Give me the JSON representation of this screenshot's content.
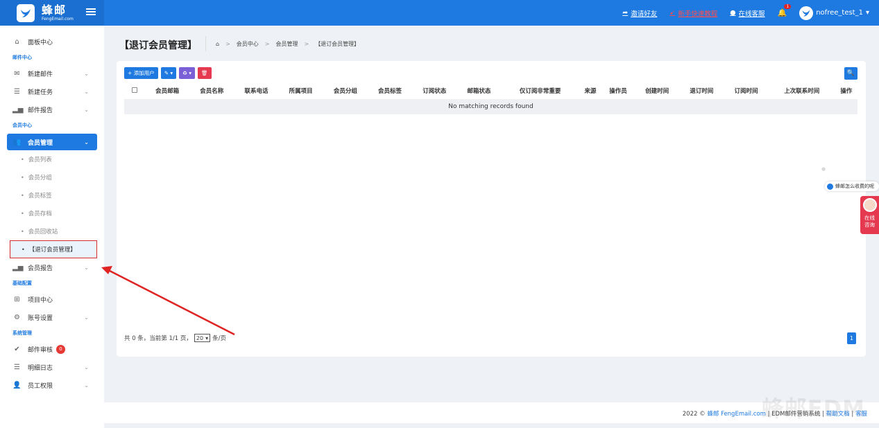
{
  "brand": {
    "name_cn": "蜂邮",
    "name_en": "FengEmail.com"
  },
  "topbar": {
    "invite": "邀请好友",
    "tutorial": "新手快速教程",
    "support": "在线客服",
    "bell_count": "1",
    "username": "nofree_test_1"
  },
  "sidebar": {
    "dashboard": "面板中心",
    "section_mail": "邮件中心",
    "new_mail": "新建邮件",
    "new_task": "新建任务",
    "mail_report": "邮件报告",
    "section_member": "会员中心",
    "member_manage": "会员管理",
    "sub": [
      "会员列表",
      "会员分组",
      "会员标签",
      "会员存档",
      "会员回收站",
      "【退订会员管理】"
    ],
    "member_report": "会员报告",
    "section_base": "基础配置",
    "project_center": "项目中心",
    "account_settings": "账号设置",
    "section_system": "系统管理",
    "mail_review": "邮件审核",
    "review_count": "0",
    "detail_log": "明细日志",
    "staff_perm": "员工权限"
  },
  "page": {
    "title": "【退订会员管理】",
    "breadcrumb": [
      "会员中心",
      "会员管理",
      "【退订会员管理】"
    ]
  },
  "toolbar": {
    "add_user": "添加用户"
  },
  "table": {
    "columns": [
      "会员邮箱",
      "会员名称",
      "联系电话",
      "所属项目",
      "会员分组",
      "会员标签",
      "订阅状态",
      "邮箱状态",
      "仅订阅非常重要",
      "来源",
      "操作员",
      "创建时间",
      "退订时间",
      "订阅时间",
      "上次联系时间",
      "操作"
    ],
    "empty": "No matching records found"
  },
  "pager": {
    "summary": "共 0 条，当前第 1/1 页，",
    "page_size": "20",
    "unit": "条/页",
    "current_page": "1"
  },
  "footer": {
    "prefix": "2022 © ",
    "brand_link": "蜂邮 FengEmail.com",
    "middle": " | EDM邮件营销系统 | ",
    "help": "帮助文档",
    "sep": " | ",
    "service": "客服",
    "watermark": "蜂邮EDM"
  },
  "float": {
    "question": "蜂邮怎么收费的呢",
    "chat": "在线咨询"
  }
}
